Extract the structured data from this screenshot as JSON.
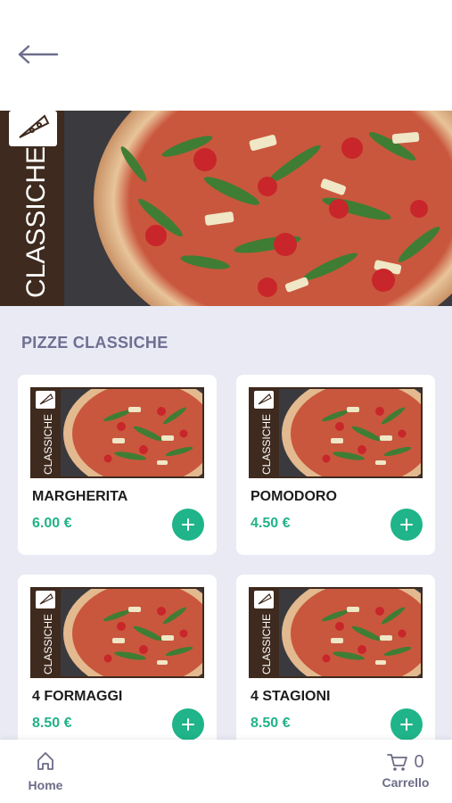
{
  "header": {
    "back_icon": "arrow-left-icon"
  },
  "banner": {
    "category_text": "CLASSICHE",
    "badge_icon": "pizza-slice-icon"
  },
  "section": {
    "title": "PIZZE CLASSICHE"
  },
  "products": [
    {
      "name": "MARGHERITA",
      "price": "6.00 €",
      "thumb_text": "CLASSICHE"
    },
    {
      "name": "POMODORO",
      "price": "4.50 €",
      "thumb_text": "CLASSICHE"
    },
    {
      "name": "4 FORMAGGI",
      "price": "8.50 €",
      "thumb_text": "CLASSICHE"
    },
    {
      "name": "4 STAGIONI",
      "price": "8.50 €",
      "thumb_text": "CLASSICHE"
    }
  ],
  "nav": {
    "home_label": "Home",
    "cart_label": "Carrello",
    "cart_count": "0"
  },
  "colors": {
    "accent": "#1fb489",
    "price": "#21b288",
    "background": "#e9eaf4",
    "banner_brown": "#3e2a1e"
  }
}
